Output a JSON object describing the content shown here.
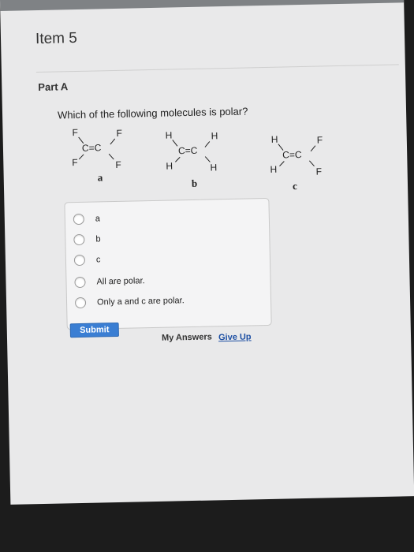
{
  "item": {
    "title": "Item 5"
  },
  "part": {
    "title": "Part A"
  },
  "question": {
    "text": "Which of the following molecules is polar?"
  },
  "molecules": [
    {
      "label": "a",
      "atoms": {
        "top_left": "F",
        "top_right": "F",
        "bottom_left": "F",
        "bottom_right": "F"
      },
      "bond": "C=C"
    },
    {
      "label": "b",
      "atoms": {
        "top_left": "H",
        "top_right": "H",
        "bottom_left": "H",
        "bottom_right": "H"
      },
      "bond": "C=C"
    },
    {
      "label": "c",
      "atoms": {
        "top_left": "H",
        "top_right": "F",
        "bottom_left": "H",
        "bottom_right": "F"
      },
      "bond": "C=C"
    }
  ],
  "choices": [
    {
      "label": "a"
    },
    {
      "label": "b"
    },
    {
      "label": "c"
    },
    {
      "label": "All are polar."
    },
    {
      "label": "Only a and c are polar."
    }
  ],
  "actions": {
    "submit_label": "Submit",
    "my_answers_label": "My Answers",
    "give_up_label": "Give Up"
  },
  "colors": {
    "submit_bg": "#3a7ed3",
    "link": "#1d4fa3"
  }
}
